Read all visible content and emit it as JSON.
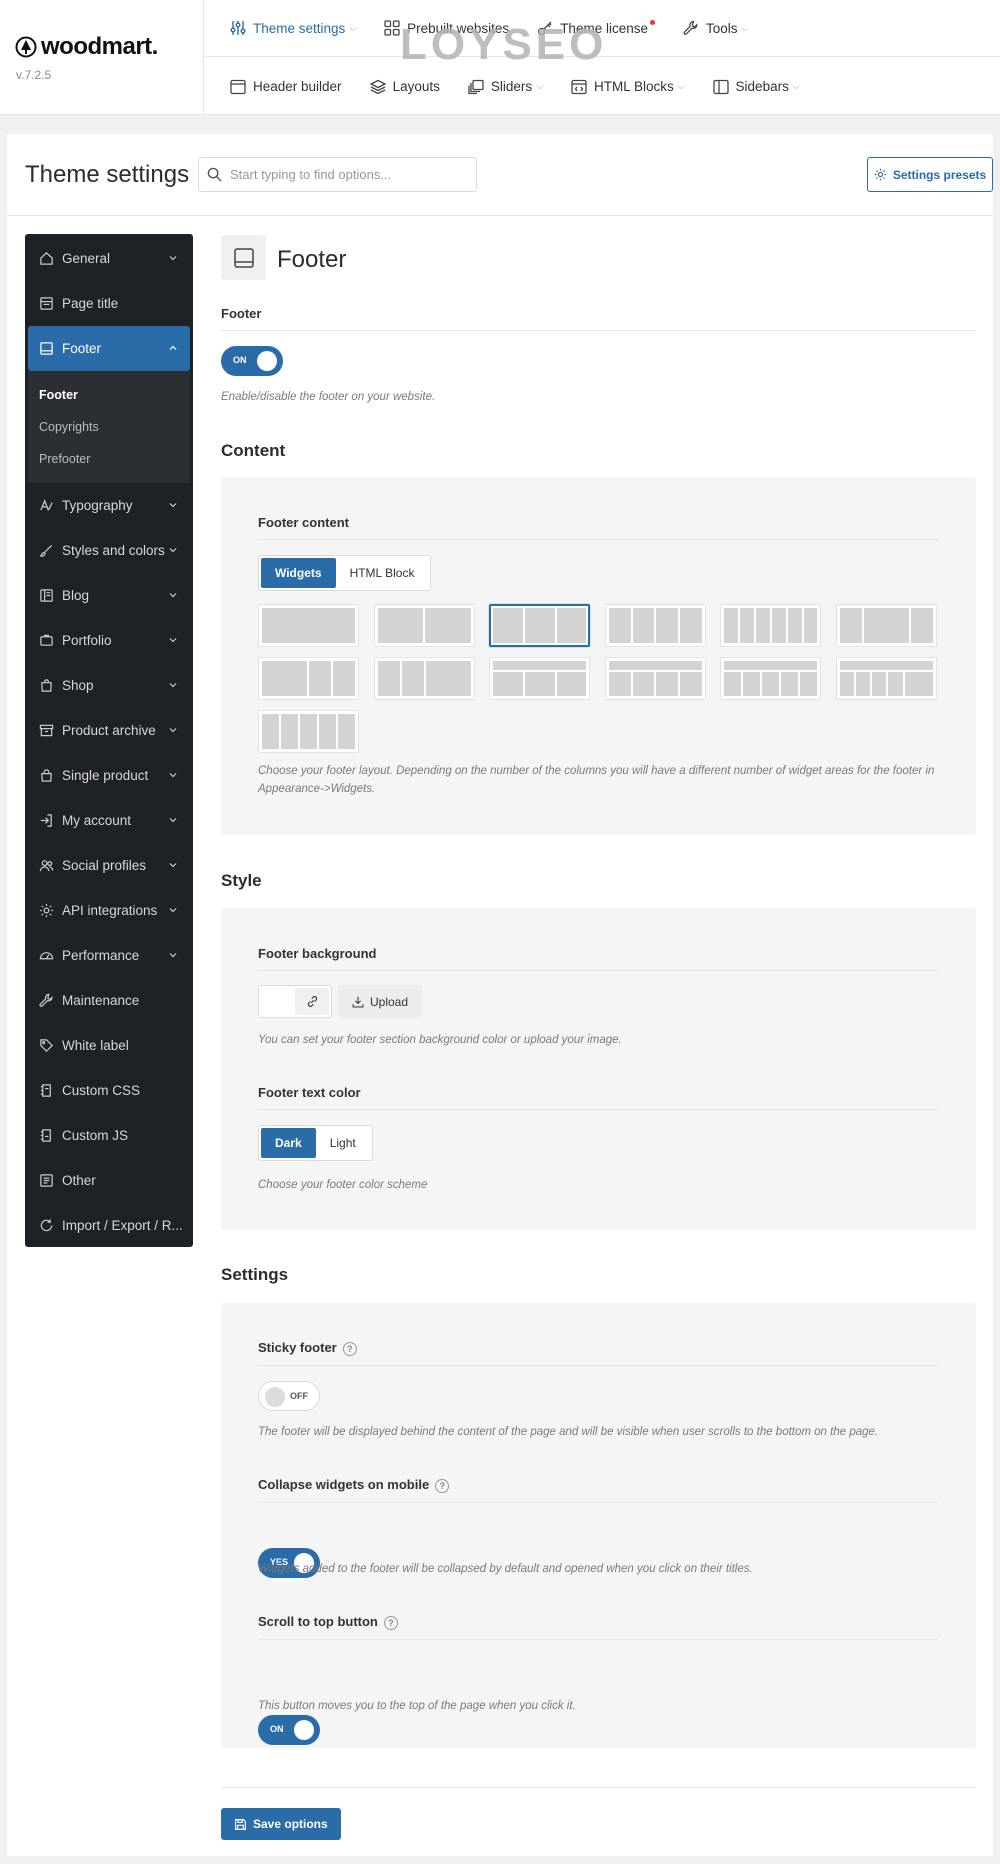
{
  "brand": {
    "logo_text": "woodmart.",
    "version": "v.7.2.5"
  },
  "topnav": {
    "row1": [
      {
        "label": "Theme settings",
        "icon": "sliders-icon",
        "active": true,
        "dropdown": true
      },
      {
        "label": "Prebuilt websites",
        "icon": "grid-icon"
      },
      {
        "label": "Theme license",
        "icon": "key-icon",
        "badge": true
      },
      {
        "label": "Tools",
        "icon": "wrench-icon",
        "dropdown": true
      }
    ],
    "row2": [
      {
        "label": "Header builder",
        "icon": "header-icon"
      },
      {
        "label": "Layouts",
        "icon": "layers-icon"
      },
      {
        "label": "Sliders",
        "icon": "slides-icon",
        "dropdown": true
      },
      {
        "label": "HTML Blocks",
        "icon": "code-block-icon",
        "dropdown": true
      },
      {
        "label": "Sidebars",
        "icon": "sidebar-icon",
        "dropdown": true
      }
    ]
  },
  "watermark": "LOYSEO",
  "header": {
    "title": "Theme settings",
    "search_placeholder": "Start typing to find options...",
    "presets_label": "Settings presets"
  },
  "sidebar": {
    "items": [
      {
        "label": "General",
        "icon": "home-icon",
        "chevron": "down"
      },
      {
        "label": "Page title",
        "icon": "page-title-icon"
      },
      {
        "label": "Footer",
        "icon": "footer-icon",
        "chevron": "up",
        "active": true
      },
      {
        "label": "Typography",
        "icon": "typography-icon",
        "chevron": "down"
      },
      {
        "label": "Styles and colors",
        "icon": "brush-icon",
        "chevron": "down"
      },
      {
        "label": "Blog",
        "icon": "blog-icon",
        "chevron": "down"
      },
      {
        "label": "Portfolio",
        "icon": "portfolio-icon",
        "chevron": "down"
      },
      {
        "label": "Shop",
        "icon": "bag-icon",
        "chevron": "down"
      },
      {
        "label": "Product archive",
        "icon": "archive-icon",
        "chevron": "down"
      },
      {
        "label": "Single product",
        "icon": "lock-bag-icon",
        "chevron": "down"
      },
      {
        "label": "My account",
        "icon": "login-icon",
        "chevron": "down"
      },
      {
        "label": "Social profiles",
        "icon": "users-icon",
        "chevron": "down"
      },
      {
        "label": "API integrations",
        "icon": "gear-icon",
        "chevron": "down"
      },
      {
        "label": "Performance",
        "icon": "gauge-icon",
        "chevron": "down"
      },
      {
        "label": "Maintenance",
        "icon": "wrench-icon"
      },
      {
        "label": "White label",
        "icon": "tag-icon"
      },
      {
        "label": "Custom CSS",
        "icon": "css-icon"
      },
      {
        "label": "Custom JS",
        "icon": "js-icon"
      },
      {
        "label": "Other",
        "icon": "list-icon"
      },
      {
        "label": "Import / Export / R...",
        "icon": "refresh-icon"
      }
    ],
    "subitems": [
      {
        "label": "Footer",
        "active": true
      },
      {
        "label": "Copyrights"
      },
      {
        "label": "Prefooter"
      }
    ]
  },
  "content": {
    "section_title": "Footer",
    "footer_toggle": {
      "label": "Footer",
      "state": "ON",
      "desc": "Enable/disable the footer on your website."
    },
    "content_heading": "Content",
    "footer_content": {
      "label": "Footer content",
      "tabs": [
        "Widgets",
        "HTML Block"
      ],
      "selected_tab": "Widgets",
      "selected_layout_index": 2,
      "desc": "Choose your footer layout. Depending on the number of the columns you will have a different number of widget areas for the footer in Appearance->Widgets."
    },
    "style_heading": "Style",
    "footer_background": {
      "label": "Footer background",
      "upload_label": "Upload",
      "desc": "You can set your footer section background color or upload your image."
    },
    "footer_text_color": {
      "label": "Footer text color",
      "options": [
        "Dark",
        "Light"
      ],
      "selected": "Dark",
      "desc": "Choose your footer color scheme"
    },
    "settings_heading": "Settings",
    "sticky_footer": {
      "label": "Sticky footer",
      "state": "OFF",
      "desc": "The footer will be displayed behind the content of the page and will be visible when user scrolls to the bottom on the page."
    },
    "collapse_widgets": {
      "label": "Collapse widgets on mobile",
      "state": "YES",
      "desc": "Widgets added to the footer will be collapsed by default and opened when you click on their titles."
    },
    "scroll_to_top": {
      "label": "Scroll to top button",
      "state": "ON",
      "desc": "This button moves you to the top of the page when you click it."
    },
    "save_label": "Save options"
  },
  "colors": {
    "accent": "#2a6ca8",
    "sidebar_bg": "#1e2125",
    "badge": "#e0383e"
  }
}
